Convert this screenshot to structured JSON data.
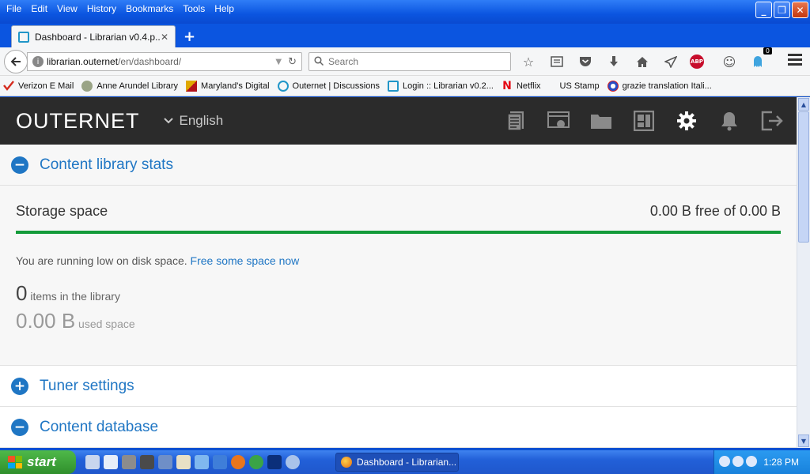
{
  "browser": {
    "menu": [
      "File",
      "Edit",
      "View",
      "History",
      "Bookmarks",
      "Tools",
      "Help"
    ],
    "tab_title": "Dashboard - Librarian v0.4.p...",
    "url_host": "librarian.outernet",
    "url_path": "/en/dashboard/",
    "search_placeholder": "Search",
    "notification_badge": "0",
    "bookmarks": [
      {
        "label": "Verizon E Mail",
        "icon": "verizon-icon"
      },
      {
        "label": "Anne Arundel Library",
        "icon": "library-icon"
      },
      {
        "label": "Maryland's Digital",
        "icon": "maryland-flag-icon"
      },
      {
        "label": "Outernet | Discussions",
        "icon": "outernet-icon"
      },
      {
        "label": "Login :: Librarian v0.2...",
        "icon": "librarian-icon"
      },
      {
        "label": "Netflix",
        "icon": "netflix-icon"
      },
      {
        "label": "US Stamp",
        "icon": "stamp-icon"
      },
      {
        "label": "grazie translation Itali...",
        "icon": "translate-icon"
      }
    ]
  },
  "app": {
    "logo": "OUTERNET",
    "language": "English",
    "header_icons": [
      "content-icon",
      "apps-icon",
      "files-icon",
      "dashboard-icon",
      "settings-icon",
      "notifications-icon",
      "logout-icon"
    ]
  },
  "sections": {
    "stats": {
      "title": "Content library stats",
      "storage_label": "Storage space",
      "storage_value": "0.00 B free of 0.00 B",
      "storage_free_fraction": 1.0,
      "warning_text": "You are running low on disk space. ",
      "warning_link": "Free some space now",
      "items_count": "0",
      "items_label": " items in the library",
      "used_value": "0.00 B",
      "used_label": " used space"
    },
    "tuner": {
      "title": "Tuner settings"
    },
    "database": {
      "title": "Content database"
    }
  },
  "taskbar": {
    "start_label": "start",
    "task_title": "Dashboard - Librarian...",
    "clock": "1:28 PM"
  },
  "colors": {
    "accent": "#1f76c4",
    "progress": "#139b3a",
    "header_bg": "#2b2b2b"
  }
}
